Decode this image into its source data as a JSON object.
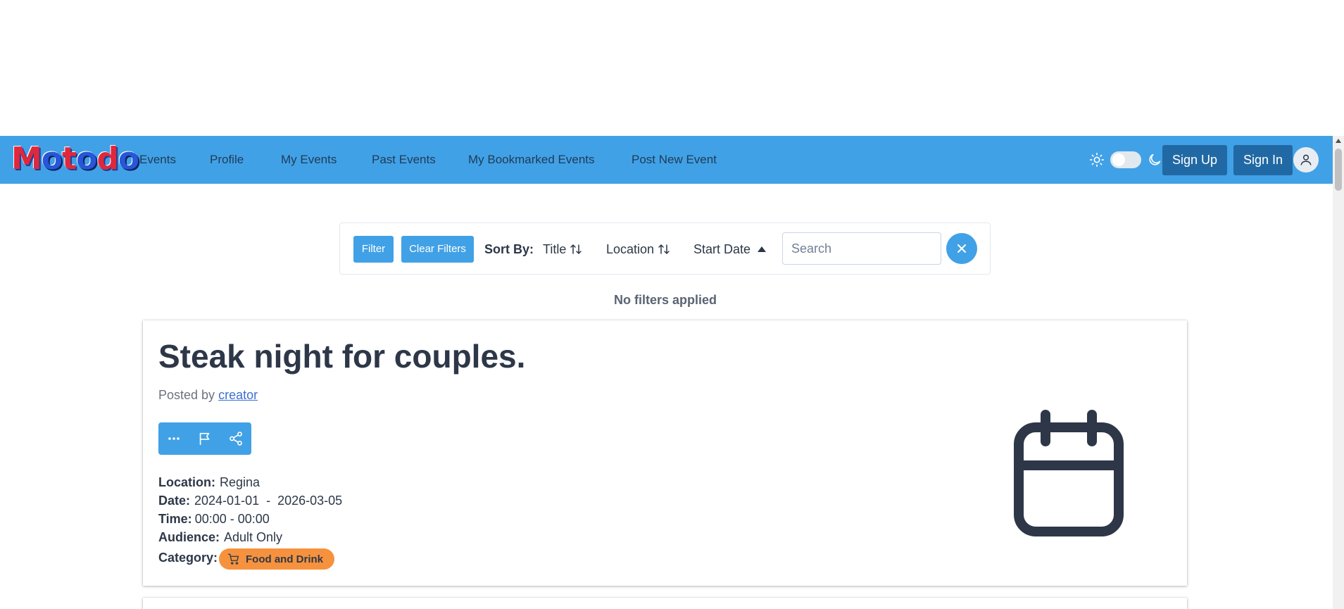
{
  "app": {
    "logo_text": "Motodo"
  },
  "nav": {
    "links": [
      "Events",
      "Profile",
      "My Events",
      "Past Events",
      "My Bookmarked Events",
      "Post New Event"
    ],
    "sign_up": "Sign Up",
    "sign_in": "Sign In",
    "theme_toggle": "light"
  },
  "filters": {
    "filter_button": "Filter",
    "clear_button": "Clear Filters",
    "sort_label": "Sort By:",
    "sort_options": [
      {
        "label": "Title",
        "icon": "sort-both-icon"
      },
      {
        "label": "Location",
        "icon": "sort-both-icon"
      },
      {
        "label": "Start Date",
        "icon": "sort-asc-icon"
      }
    ],
    "search_placeholder": "Search",
    "search_value": "",
    "status": "No filters applied"
  },
  "event": {
    "title": "Steak night for couples.",
    "posted_prefix": "Posted by",
    "creator": "creator",
    "details": {
      "location_label": "Location:",
      "location": "Regina",
      "date_label": "Date:",
      "date": "2024-01-01  -  2026-03-05",
      "time_label": "Time:",
      "time": "00:00 - 00:00",
      "audience_label": "Audience:",
      "audience": "Adult Only",
      "category_label": "Category:",
      "category": "Food and Drink"
    },
    "image_icon": "calendar-icon"
  },
  "colors": {
    "primary": "#41a1e6",
    "nav_button": "#2169a4",
    "category_badge": "#f6923d",
    "text": "#2d3748"
  }
}
